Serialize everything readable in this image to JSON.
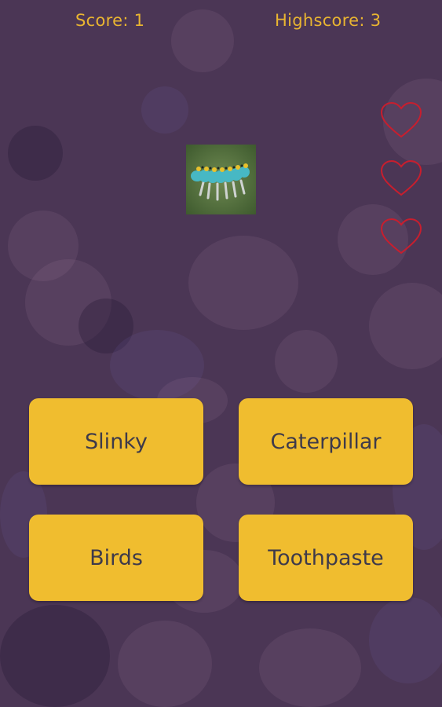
{
  "header": {
    "score_text": "Score: 1",
    "highscore_text": "Highscore: 3"
  },
  "lives": {
    "count": 3,
    "icon": "heart-outline-icon",
    "color": "#c81e2e"
  },
  "question": {
    "image_icon": "caterpillar-photo"
  },
  "answers": [
    {
      "label": "Slinky"
    },
    {
      "label": "Caterpillar"
    },
    {
      "label": "Birds"
    },
    {
      "label": "Toothpaste"
    }
  ],
  "colors": {
    "background": "#4b3655",
    "score_text": "#e9b531",
    "button": "#f0bd2f",
    "button_text": "#3e3a4a"
  }
}
